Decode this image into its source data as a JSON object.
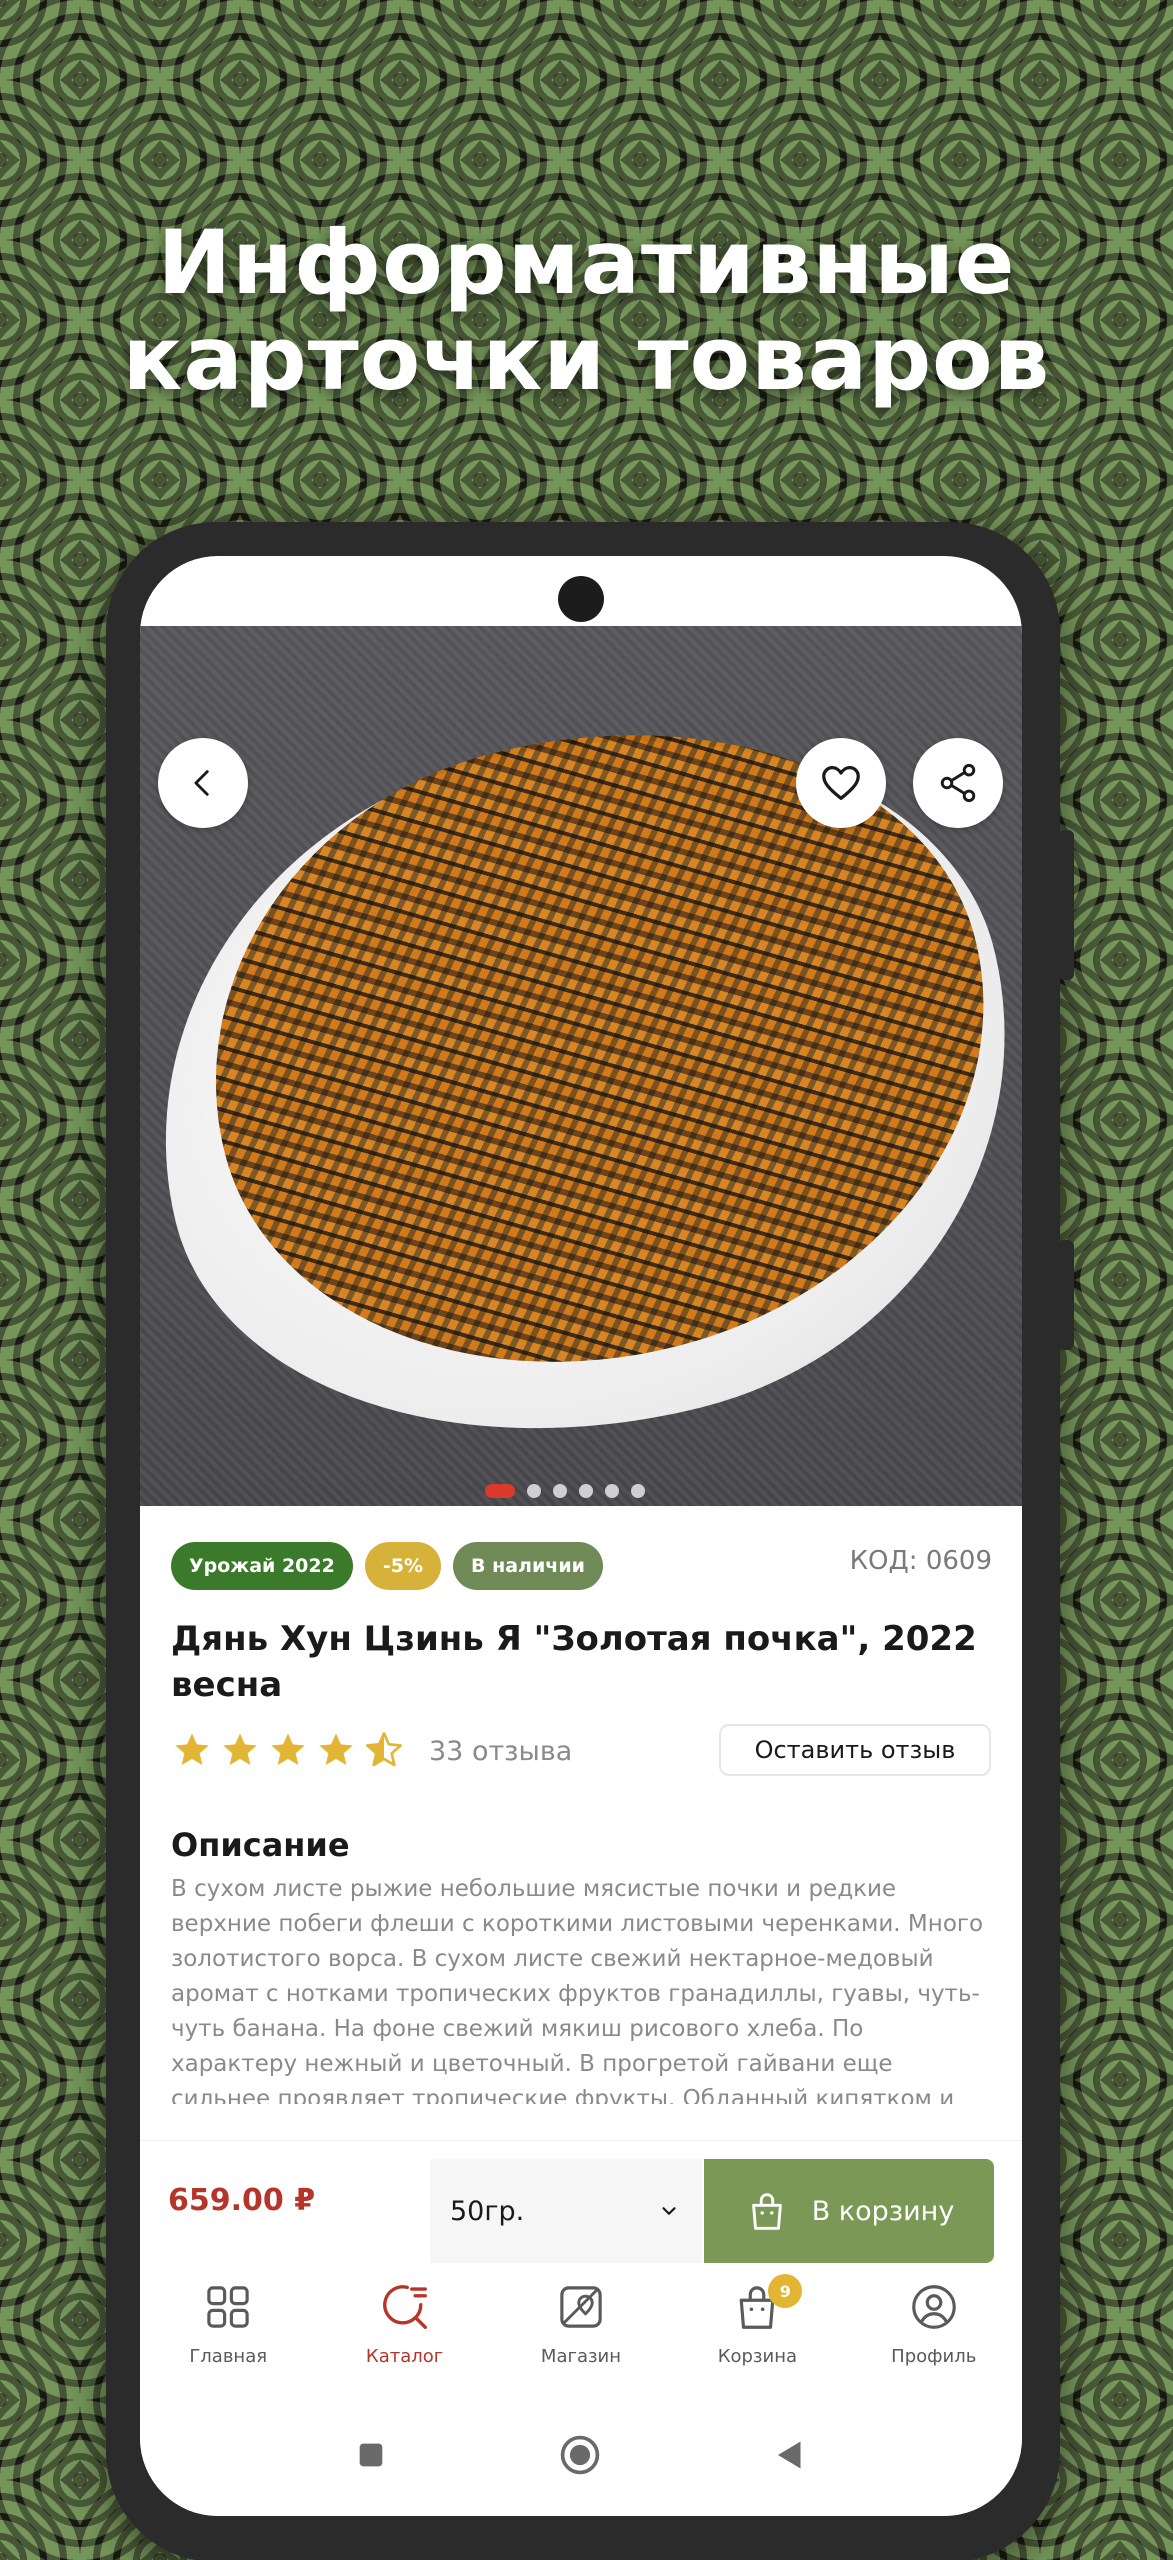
{
  "headline": {
    "line1": "Информативные",
    "line2": "карточки товаров"
  },
  "colors": {
    "accent_green": "#7b9857",
    "price_red": "#b5352b",
    "badge_harvest": "#3b7a2a",
    "badge_discount": "#d6b23a",
    "badge_stock": "#6f8a57"
  },
  "product": {
    "badges": {
      "harvest": "Урожай 2022",
      "discount": "-5%",
      "stock": "В наличии"
    },
    "code": "КОД: 0609",
    "title": "Дянь Хун Цзинь Я \"Золотая почка\", 2022 весна",
    "rating": 4.5,
    "reviews_text": "33 отзыва",
    "review_button": "Оставить отзыв",
    "description_title": "Описание",
    "description": "В сухом листе рыжие небольшие мясистые почки и редкие верхние побеги флеши с короткими листовыми черенками. Много золотистого ворса. В сухом листе свежий нектарное-медовый аромат с нотками тропических фруктов гранадиллы, гуавы, чуть-чуть банана. На фоне свежий мякиш рисового хлеба. По характеру нежный и цветочный. В прогретой гайвани еще сильнее проявляет тропические фрукты.   Обданный кипятком и вовсе с трудом напоминает типичный дяньхун. Появляются оттенки"
  },
  "purchase": {
    "price": "659.00 ₽",
    "weight": "50гр.",
    "cart_button": "В корзину"
  },
  "tabbar": {
    "home": "Главная",
    "catalog": "Каталог",
    "shop": "Магазин",
    "cart": "Корзина",
    "cart_count": "9",
    "profile": "Профиль"
  },
  "icons": {
    "back": "chevron-left-icon",
    "favorite": "heart-icon",
    "share": "share-icon"
  }
}
